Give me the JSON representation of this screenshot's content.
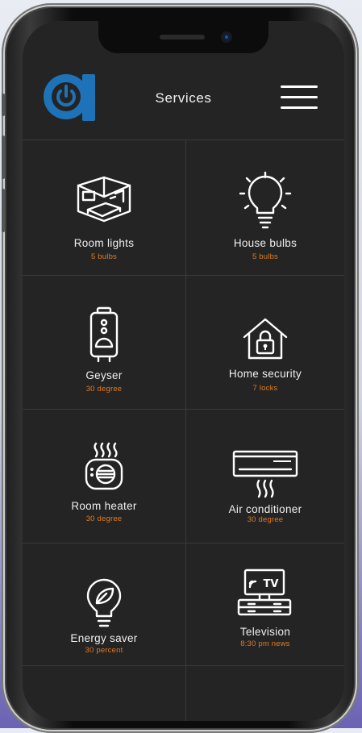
{
  "header": {
    "logo_letter": "a",
    "title": "Services",
    "brand_color": "#1e73b8",
    "icons": {
      "logo": "power-icon",
      "menu": "hamburger-menu-icon"
    }
  },
  "colors": {
    "background": "#242424",
    "subtext": "#e07a22",
    "text": "#f0f0f0"
  },
  "services": [
    {
      "title": "Room lights",
      "sub": "5 bulbs",
      "icon": "room-icon"
    },
    {
      "title": "House bulbs",
      "sub": "5 bulbs",
      "icon": "bulb-icon"
    },
    {
      "title": "Geyser",
      "sub": "30 degree",
      "icon": "geyser-icon"
    },
    {
      "title": "Home security",
      "sub": "7 locks",
      "icon": "house-lock-icon"
    },
    {
      "title": "Room heater",
      "sub": "30 degree",
      "icon": "heater-icon"
    },
    {
      "title": "Air conditioner",
      "sub": "30 degree",
      "icon": "air-conditioner-icon"
    },
    {
      "title": "Energy saver",
      "sub": "30 percent",
      "icon": "leaf-bulb-icon"
    },
    {
      "title": "Television",
      "sub": "8:30 pm news",
      "icon": "tv-icon",
      "screen_text": "TV"
    }
  ]
}
